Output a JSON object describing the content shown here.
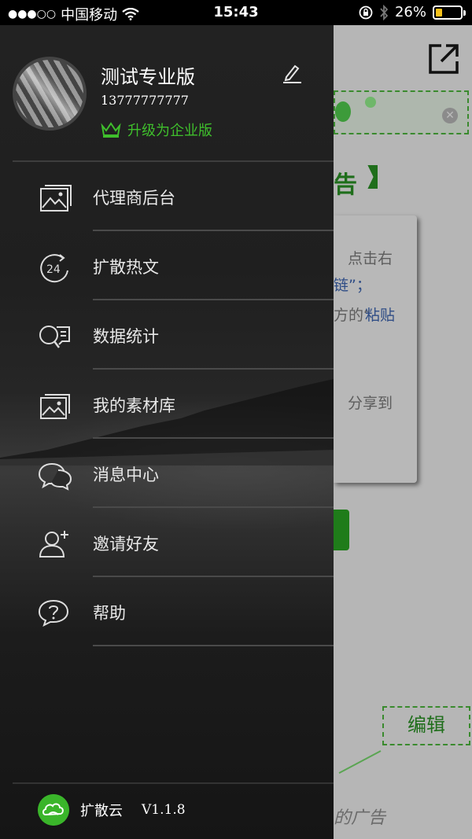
{
  "status_bar": {
    "signal": "●●●○○",
    "carrier": "中国移动",
    "time": "15:43",
    "battery_percent": "26%",
    "battery_level": 0.26
  },
  "drawer": {
    "user": {
      "name": "测试专业版",
      "phone": "13777777777",
      "upgrade_label": "升级为企业版"
    },
    "menu": [
      {
        "label": "代理商后台",
        "icon": "image-frame-icon"
      },
      {
        "label": "扩散热文",
        "icon": "24-hour-icon"
      },
      {
        "label": "数据统计",
        "icon": "search-chat-icon"
      },
      {
        "label": "我的素材库",
        "icon": "gallery-icon"
      },
      {
        "label": "消息中心",
        "icon": "chat-bubbles-icon"
      },
      {
        "label": "邀请好友",
        "icon": "add-user-icon"
      },
      {
        "label": "帮助",
        "icon": "help-bubble-icon"
      }
    ],
    "footer": {
      "app_name": "扩散云",
      "version": "V1.1.8"
    }
  },
  "background_page": {
    "headline_fragment": "告",
    "card_lines": [
      "点击右",
      "链”；",
      "方的“",
      "粘贴",
      "分享到"
    ],
    "edit_label": "编辑",
    "bottom_fragment": "的广告"
  },
  "colors": {
    "accent_green": "#3fbf2c",
    "drawer_bg": "#1f1f1f"
  }
}
